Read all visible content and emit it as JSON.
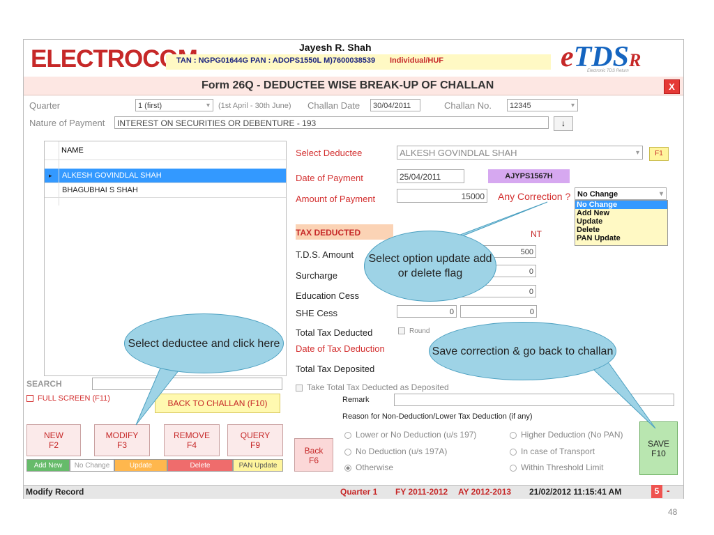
{
  "header": {
    "logo": "ELECTROCOM",
    "user_name": "Jayesh R. Shah",
    "tan_line": "TAN : NGPG01644G  PAN : ADOPS1550L  M)7600038539",
    "type": "Individual/HUF",
    "brand": "eTDS",
    "brand_suffix": "R",
    "brand_sub": "Electronic TDS Return"
  },
  "title": "Form 26Q - DEDUCTEE WISE BREAK-UP OF CHALLAN",
  "close_label": "X",
  "filters": {
    "quarter_label": "Quarter",
    "quarter_value": "1 (first)",
    "quarter_range": "(1st April - 30th June)",
    "challan_date_label": "Challan Date",
    "challan_date": "30/04/2011",
    "challan_no_label": "Challan No.",
    "challan_no": "12345",
    "nature_label": "Nature of Payment",
    "nature_value": "INTEREST ON SECURITIES OR DEBENTURE - 193",
    "down_button": "↓"
  },
  "grid": {
    "header": "NAME",
    "rows": [
      "ALKESH GOVINDLAL SHAH",
      "BHAGUBHAI S SHAH"
    ],
    "row_marker": "▸"
  },
  "left_panel": {
    "search_label": "SEARCH",
    "fullscreen_label": "FULL SCREEN (F11)",
    "back_to_challan": "BACK TO CHALLAN (F10)",
    "buttons": [
      {
        "label": "NEW",
        "key": "F2"
      },
      {
        "label": "MODIFY",
        "key": "F3"
      },
      {
        "label": "REMOVE",
        "key": "F4"
      },
      {
        "label": "QUERY",
        "key": "F9"
      }
    ],
    "flags": [
      "Add New",
      "No Change",
      "Update",
      "Delete",
      "PAN Update"
    ]
  },
  "form": {
    "select_deductee_label": "Select Deductee",
    "select_deductee_value": "ALKESH GOVINDLAL SHAH",
    "f1_label": "F1",
    "date_of_payment_label": "Date of Payment",
    "date_of_payment": "25/04/2011",
    "pan": "AJYPS1567H",
    "amount_label": "Amount of Payment",
    "amount": "15000",
    "correction_label": "Any Correction ?",
    "correction_value": "No Change",
    "correction_options": [
      "No Change",
      "Add New",
      "Update",
      "Delete",
      "PAN Update"
    ],
    "tax_deducted_label": "TAX DEDUCTED",
    "nt_label": "NT",
    "tds_label": "T.D.S. Amount",
    "tds_value": "500",
    "surcharge_label": "Surcharge",
    "surcharge_value": "0",
    "edu_cess_label": "Education Cess",
    "edu_cess_value": "0",
    "she_cess_label": "SHE Cess",
    "she_cess_a": "0",
    "she_cess_b": "0",
    "total_deducted_label": "Total Tax Deducted",
    "round_label": "Round",
    "date_tax_deduction_label": "Date of Tax Deduction",
    "total_deposited_label": "Total Tax Deposited",
    "take_total_label": "Take Total Tax Deducted as Deposited",
    "remark_label": "Remark",
    "reason_label": "Reason for Non-Deduction/Lower Tax Deduction (if any)",
    "reasons": [
      "Lower or No Deduction (u/s 197)",
      "Higher Deduction (No PAN)",
      "No Deduction (u/s 197A)",
      "In case of Transport",
      "Otherwise",
      "Within Threshold Limit"
    ],
    "back_label": "Back",
    "back_key": "F6",
    "save_label": "SAVE",
    "save_key": "F10"
  },
  "status": {
    "mode": "Modify Record",
    "quarter": "Quarter 1",
    "fy": "FY 2011-2012",
    "ay": "AY 2012-2013",
    "datetime": "21/02/2012 11:15:41 AM",
    "count": "5",
    "minus": "-"
  },
  "callouts": {
    "select_option": "Select option update add or delete flag",
    "select_deductee": "Select deductee and click here",
    "save_correction": "Save correction & go back to challan"
  },
  "slide_number": "48",
  "colors": {
    "accent_red": "#d32f2f",
    "selection_blue": "#3399ff",
    "callout": "#9ed3e6",
    "pan_bg": "#d6a8f0",
    "save_green": "#b9e6b0"
  }
}
